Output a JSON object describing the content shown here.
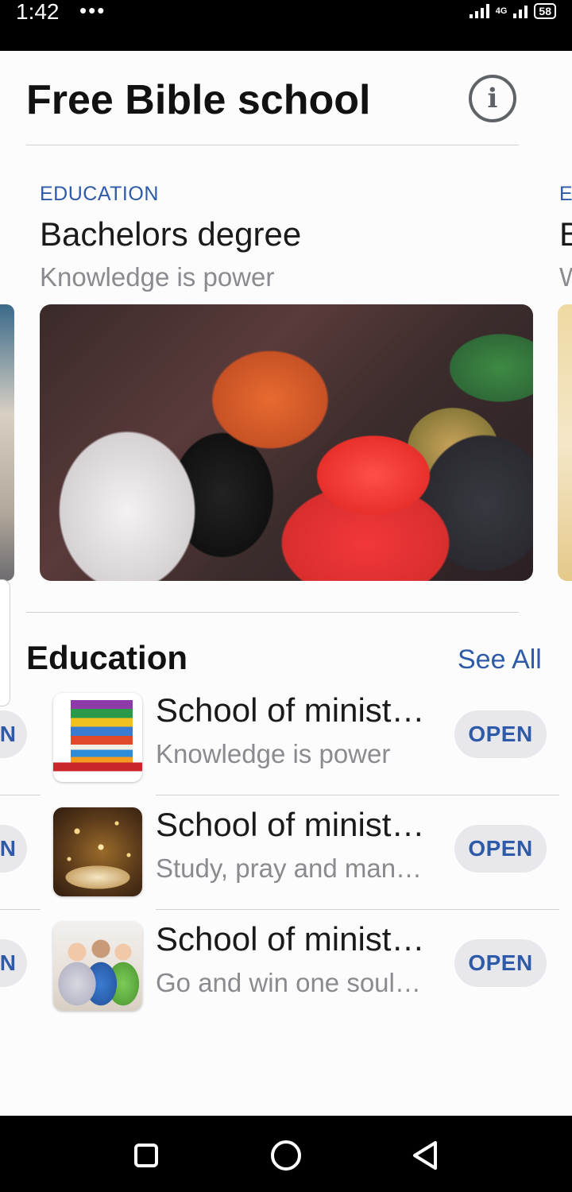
{
  "status_bar": {
    "time": "1:42",
    "dots": "•••",
    "network": "4G",
    "battery": "58"
  },
  "header": {
    "title": "Free Bible school",
    "info_icon": "info-icon"
  },
  "featured": {
    "category": "EDUCATION",
    "title": "Bachelors degree",
    "subtitle": "Knowledge is power",
    "image": "congregation-photo"
  },
  "featured_next_peek": {
    "category": "E",
    "title": "B",
    "subtitle": "W"
  },
  "section": {
    "title": "Education",
    "see_all": "See All"
  },
  "apps": [
    {
      "title": "School of minist…",
      "subtitle": "Knowledge is power",
      "button": "OPEN",
      "icon": "books-icon"
    },
    {
      "title": "School of minist…",
      "subtitle": "Study, pray and man…",
      "button": "OPEN",
      "icon": "bible-icon"
    },
    {
      "title": "School of minist…",
      "subtitle": "Go and win one soul…",
      "button": "OPEN",
      "icon": "children-reading-icon"
    }
  ],
  "peek_button": "N",
  "nav": {
    "recents": "recents-icon",
    "home": "home-icon",
    "back": "back-icon"
  },
  "colors": {
    "accent": "#2e5aa8",
    "button_bg": "#e8e8ec",
    "bar_bg": "#000000"
  }
}
